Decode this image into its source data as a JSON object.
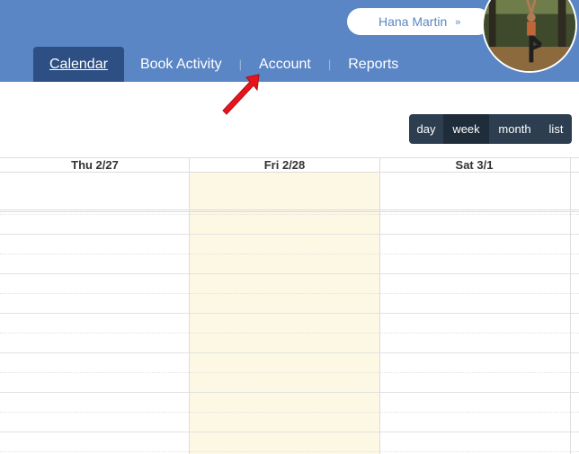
{
  "header": {
    "user_name": "Hana Martin",
    "user_chevron": "»",
    "nav": [
      {
        "label": "Calendar",
        "active": true
      },
      {
        "label": "Book Activity",
        "active": false
      },
      {
        "label": "Account",
        "active": false
      },
      {
        "label": "Reports",
        "active": false
      }
    ],
    "separator": "|"
  },
  "view_toggle": {
    "day": "day",
    "week": "week",
    "month": "month",
    "list": "list",
    "selected": "week"
  },
  "calendar": {
    "columns": [
      "Thu 2/27",
      "Fri 2/28",
      "Sat 3/1"
    ],
    "today_column": "Fri 2/28"
  },
  "colors": {
    "header_bg": "#5b86c5",
    "active_tab": "#2d4f83",
    "toggle_bg": "#2c3e50",
    "today_bg": "#fcf8e3",
    "pointer": "#e8141c"
  },
  "icons": {
    "user_menu": "chevron-down-double-icon",
    "pointer": "red-arrow-icon"
  }
}
